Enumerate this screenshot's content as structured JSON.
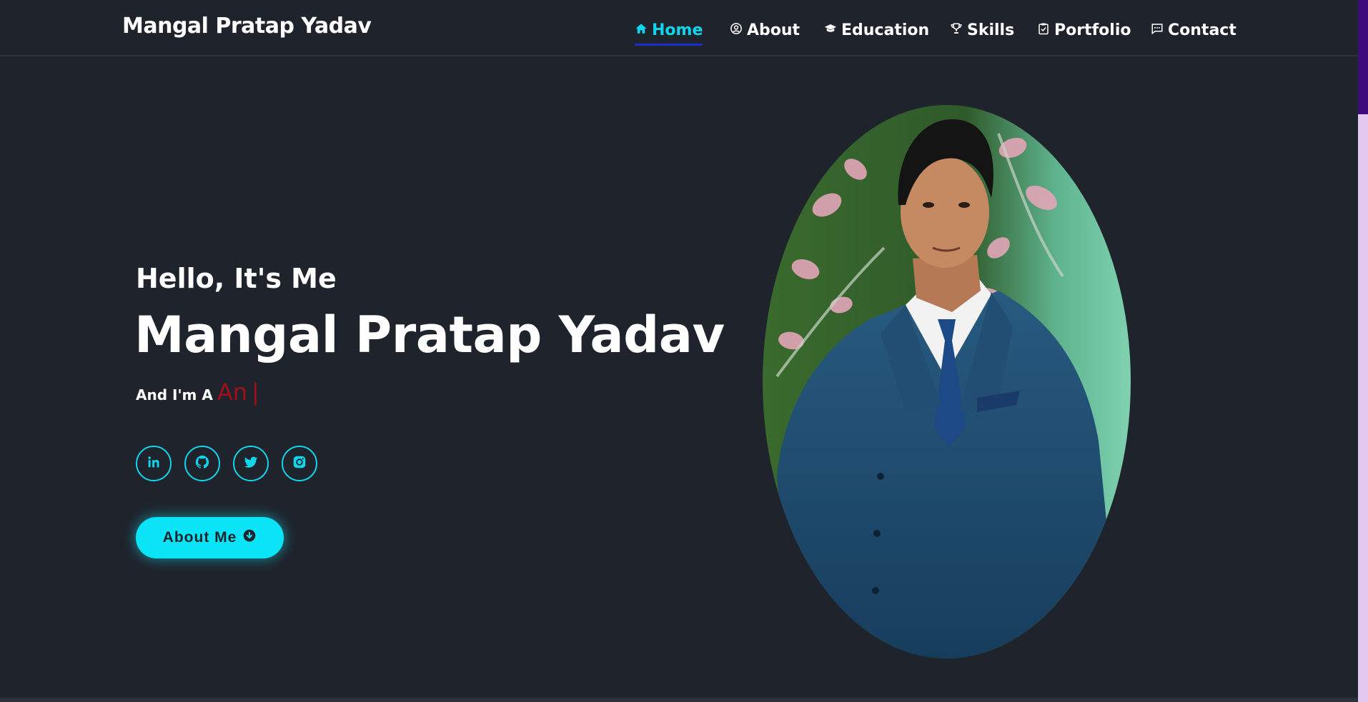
{
  "header": {
    "logo": "Mangal Pratap Yadav",
    "nav": [
      {
        "label": "Home",
        "icon": "home-icon",
        "active": true
      },
      {
        "label": "About",
        "icon": "user-circle-icon",
        "active": false
      },
      {
        "label": "Education",
        "icon": "graduation-cap-icon",
        "active": false
      },
      {
        "label": "Skills",
        "icon": "trophy-icon",
        "active": false
      },
      {
        "label": "Portfolio",
        "icon": "clipboard-check-icon",
        "active": false
      },
      {
        "label": "Contact",
        "icon": "message-icon",
        "active": false
      }
    ]
  },
  "hero": {
    "greeting": "Hello, It's Me",
    "name": "Mangal Pratap Yadav",
    "role_prefix": "And I'm A",
    "role_typed": "An",
    "role_cursor": "|",
    "socials": [
      {
        "icon": "linkedin-icon"
      },
      {
        "icon": "github-icon"
      },
      {
        "icon": "twitter-icon"
      },
      {
        "icon": "instagram-icon"
      }
    ],
    "cta_label": "About Me",
    "cta_icon": "arrow-circle-down-icon"
  },
  "colors": {
    "background": "#1f232c",
    "accent": "#10d6ec",
    "button": "#0be3f7",
    "typed_text": "#a0101a",
    "active_underline": "#1c2fcc",
    "scrollbar_track": "#e3c9ef",
    "scrollbar_thumb": "#3f0a7c"
  }
}
